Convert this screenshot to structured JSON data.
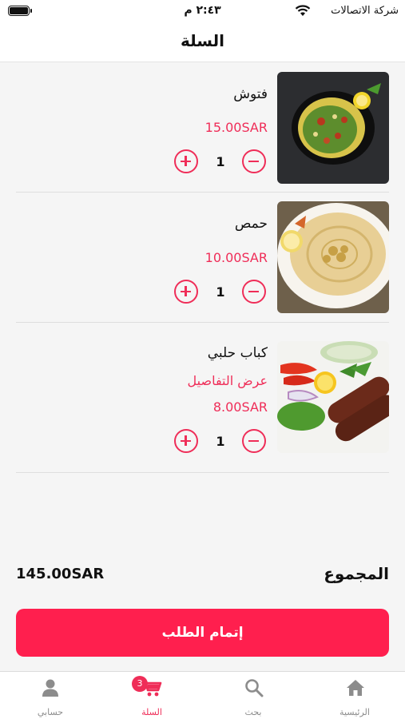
{
  "status_bar": {
    "carrier": "شركة الاتصالات",
    "time": "٢:٤٣ م"
  },
  "header": {
    "title": "السلة"
  },
  "cart": {
    "items": [
      {
        "name": "فتوش",
        "details_link": "",
        "price": "15.00SAR",
        "quantity": "1"
      },
      {
        "name": "حمص",
        "details_link": "",
        "price": "10.00SAR",
        "quantity": "1"
      },
      {
        "name": "كباب حلبي",
        "details_link": "عرض التفاصيل",
        "price": "8.00SAR",
        "quantity": "1"
      }
    ]
  },
  "summary": {
    "total_label": "المجموع",
    "total_value": "145.00SAR"
  },
  "checkout": {
    "label": "إتمام الطلب"
  },
  "tabs": [
    {
      "label": "الرئيسية",
      "icon": "home-icon"
    },
    {
      "label": "بحث",
      "icon": "search-icon"
    },
    {
      "label": "السلة",
      "icon": "cart-icon",
      "badge": "3"
    },
    {
      "label": "حسابي",
      "icon": "person-icon"
    }
  ],
  "colors": {
    "accent": "#ef2d58",
    "button": "#ff1f4e",
    "inactive": "#8c8c8c"
  }
}
